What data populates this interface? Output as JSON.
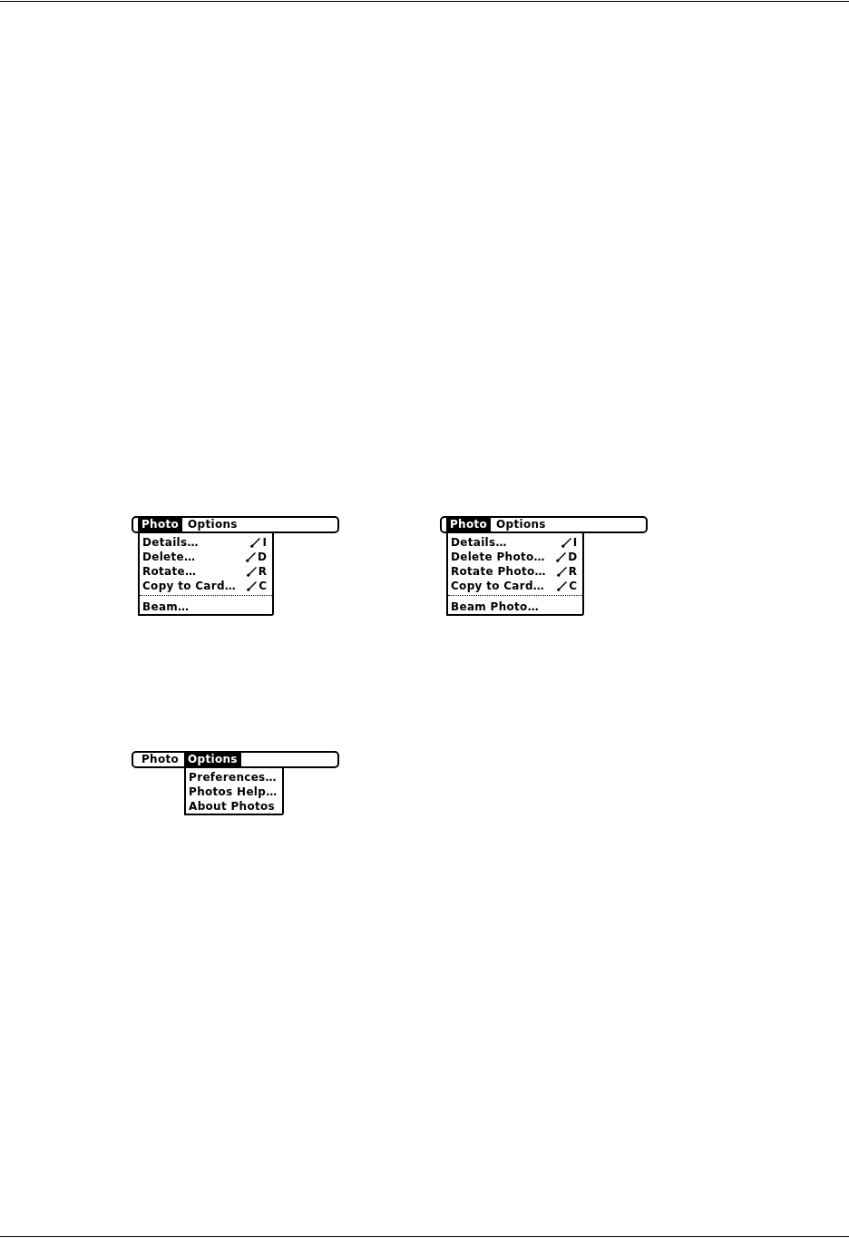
{
  "menus": [
    {
      "menubar": [
        {
          "label": "Photo",
          "selected": true
        },
        {
          "label": "Options",
          "selected": false
        }
      ],
      "items": [
        {
          "kind": "command",
          "label": "Details…",
          "shortcut": "I"
        },
        {
          "kind": "command",
          "label": "Delete…",
          "shortcut": "D"
        },
        {
          "kind": "command",
          "label": "Rotate…",
          "shortcut": "R"
        },
        {
          "kind": "command",
          "label": "Copy to Card…",
          "shortcut": "C"
        },
        {
          "kind": "separator"
        },
        {
          "kind": "command",
          "label": "Beam…"
        }
      ]
    },
    {
      "menubar": [
        {
          "label": "Photo",
          "selected": true
        },
        {
          "label": "Options",
          "selected": false
        }
      ],
      "items": [
        {
          "kind": "command",
          "label": "Details…",
          "shortcut": "I"
        },
        {
          "kind": "command",
          "label": "Delete Photo…",
          "shortcut": "D"
        },
        {
          "kind": "command",
          "label": "Rotate Photo…",
          "shortcut": "R"
        },
        {
          "kind": "command",
          "label": "Copy to Card…",
          "shortcut": "C"
        },
        {
          "kind": "separator"
        },
        {
          "kind": "command",
          "label": "Beam Photo…"
        }
      ]
    },
    {
      "menubar": [
        {
          "label": "Photo",
          "selected": false
        },
        {
          "label": "Options",
          "selected": true
        }
      ],
      "items": [
        {
          "kind": "command",
          "label": "Preferences…"
        },
        {
          "kind": "command",
          "label": "Photos Help…"
        },
        {
          "kind": "command",
          "label": "About Photos"
        }
      ]
    }
  ]
}
